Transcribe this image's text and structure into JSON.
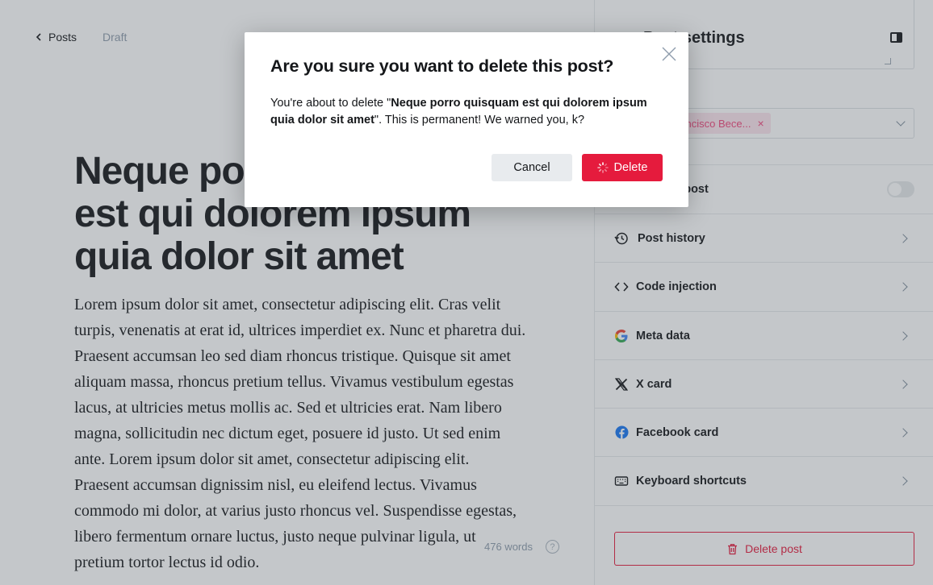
{
  "editor": {
    "back_label": "Posts",
    "status": "Draft",
    "title": "Neque porro quisquam est qui dolorem ipsum quia dolor sit amet",
    "body": "Lorem ipsum dolor sit amet, consectetur adipiscing elit. Cras velit turpis, venenatis at erat id, ultrices imperdiet ex. Nunc et pharetra dui. Praesent accumsan leo sed diam rhoncus tristique. Quisque sit amet aliquam massa, rhoncus pretium tellus. Vivamus vestibulum egestas lacus, at ultricies metus mollis ac. Sed et ultricies erat. Nam libero magna, sollicitudin nec dictum eget, posuere id justo. Ut sed enim ante. Lorem ipsum dolor sit amet, consectetur adipiscing elit. Praesent accumsan dignissim nisl, eu eleifend lectus. Vivamus commodo mi dolor, at varius justo rhoncus vel. Suspendisse egestas, libero fermentum ornare luctus, justo neque pulvinar ligula, ut pretium tortor lectus id odio.",
    "word_count": "476 words"
  },
  "settings": {
    "heading": "Post settings",
    "author_tag": "Francisco Bece...",
    "feature_label": "Feature this post",
    "items": [
      {
        "label": "Post history",
        "icon": "history-icon"
      },
      {
        "label": "Code injection",
        "icon": "code-icon"
      },
      {
        "label": "Meta data",
        "icon": "google-icon"
      },
      {
        "label": "X card",
        "icon": "x-logo-icon"
      },
      {
        "label": "Facebook card",
        "icon": "facebook-icon"
      },
      {
        "label": "Keyboard shortcuts",
        "icon": "keyboard-icon"
      }
    ],
    "delete_post_label": "Delete post"
  },
  "modal": {
    "title": "Are you sure you want to delete this post?",
    "body_prefix": "You're about to delete \"",
    "post_title": "Neque porro quisquam est qui dolorem ipsum quia dolor sit amet",
    "body_suffix": "\". This is permanent! We warned you, k?",
    "cancel_label": "Cancel",
    "delete_label": "Delete"
  },
  "colors": {
    "danger": "#e51b3d",
    "text": "#15171a",
    "muted": "#8e9cac",
    "author_tag_bg": "#fde5ed",
    "author_tag_text": "#f0477c"
  }
}
